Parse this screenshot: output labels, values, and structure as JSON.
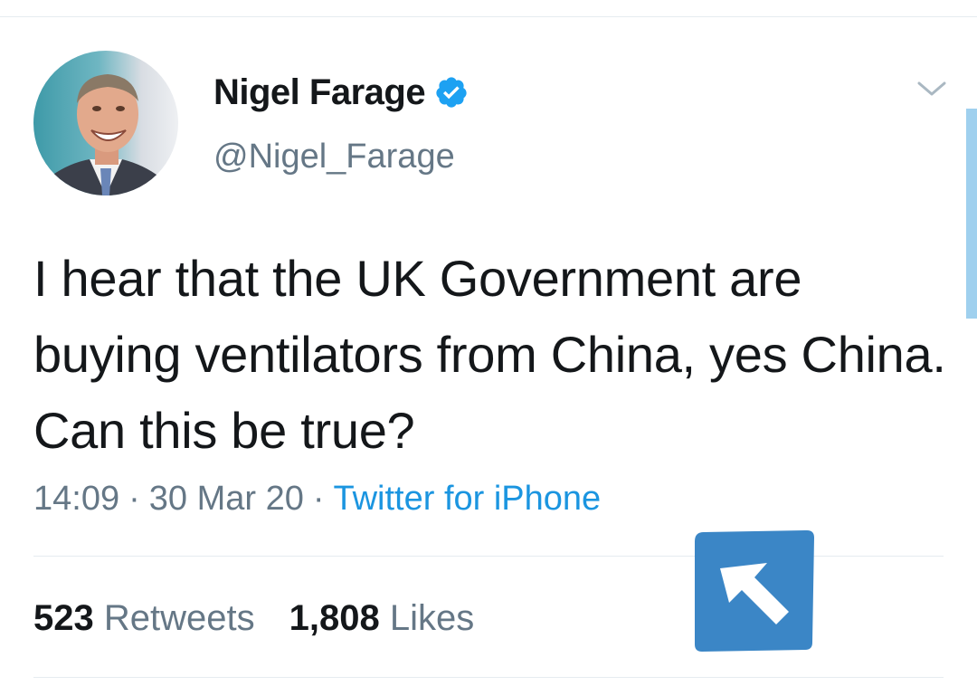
{
  "tweet": {
    "display_name": "Nigel Farage",
    "handle": "@Nigel_Farage",
    "verified": true,
    "text": "I hear that the UK Government are buying ventilators from China, yes China. Can this be true?",
    "time": "14:09",
    "date": "30 Mar 20",
    "source": "Twitter for iPhone",
    "separator": "·",
    "retweets_count": "523",
    "retweets_label": "Retweets",
    "likes_count": "1,808",
    "likes_label": "Likes"
  },
  "icons": {
    "verified": "verified-badge-icon",
    "more": "chevron-down-icon",
    "overlay": "arrow-up-left-icon"
  },
  "colors": {
    "verified_blue": "#1da1f2",
    "link_blue": "#1b95e0",
    "muted_gray": "#657786",
    "text_dark": "#14171a",
    "overlay_blue": "#3b86c6"
  }
}
